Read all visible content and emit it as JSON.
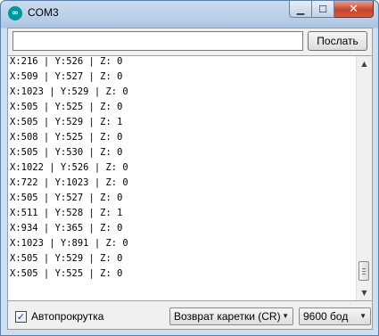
{
  "window": {
    "title": "COM3",
    "app_icon": "arduino-icon",
    "caption_icons": [
      "minimize-icon",
      "maximize-icon",
      "close-icon"
    ]
  },
  "toolbar": {
    "input_value": "",
    "send_label": "Послать"
  },
  "console": {
    "lines": [
      "X:216 | Y:526 | Z: 0",
      "X:509 | Y:527 | Z: 0",
      "X:1023 | Y:529 | Z: 0",
      "X:505 | Y:525 | Z: 0",
      "X:505 | Y:529 | Z: 1",
      "X:508 | Y:525 | Z: 0",
      "X:505 | Y:530 | Z: 0",
      "X:1022 | Y:526 | Z: 0",
      "X:722 | Y:1023 | Z: 0",
      "X:505 | Y:527 | Z: 0",
      "X:511 | Y:528 | Z: 1",
      "X:934 | Y:365 | Z: 0",
      "X:1023 | Y:891 | Z: 0",
      "X:505 | Y:529 | Z: 0",
      "X:505 | Y:525 | Z: 0"
    ]
  },
  "footer": {
    "autoscroll_label": "Автопрокрутка",
    "autoscroll_checked": true,
    "line_ending": "Возврат каретки (CR)",
    "baud_rate": "9600 бод"
  },
  "colors": {
    "title_bar": "#b9cfe8",
    "close_button": "#c7432b",
    "app_icon": "#00979c"
  }
}
